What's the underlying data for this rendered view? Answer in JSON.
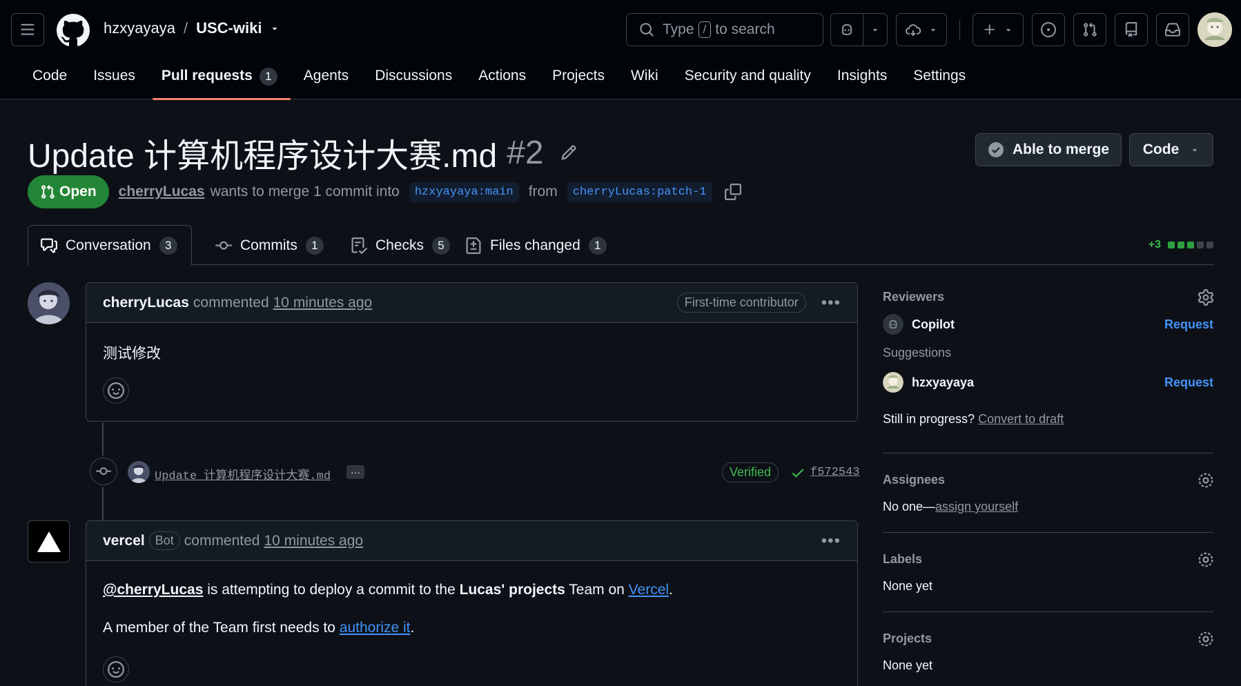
{
  "header": {
    "owner": "hzxyayaya",
    "separator": "/",
    "repo": "USC-wiki",
    "search_prefix": "Type",
    "search_key": "/",
    "search_suffix": "to search"
  },
  "nav": [
    {
      "label": "Code"
    },
    {
      "label": "Issues"
    },
    {
      "label": "Pull requests",
      "count": "1"
    },
    {
      "label": "Agents"
    },
    {
      "label": "Discussions"
    },
    {
      "label": "Actions"
    },
    {
      "label": "Projects"
    },
    {
      "label": "Wiki"
    },
    {
      "label": "Security and quality"
    },
    {
      "label": "Insights"
    },
    {
      "label": "Settings"
    }
  ],
  "pr": {
    "title": "Update 计算机程序设计大赛.md",
    "number": "#2",
    "state": "Open",
    "author": "cherryLucas",
    "merge_text": "wants to merge 1 commit into",
    "base_branch": "hzxyayaya:main",
    "from_text": "from",
    "head_branch": "cherryLucas:patch-1",
    "merge_status": "Able to merge",
    "code_button": "Code"
  },
  "tabs": [
    {
      "label": "Conversation",
      "count": "3"
    },
    {
      "label": "Commits",
      "count": "1"
    },
    {
      "label": "Checks",
      "count": "5"
    },
    {
      "label": "Files changed",
      "count": "1"
    }
  ],
  "diffstat": "+3",
  "comment1": {
    "author": "cherryLucas",
    "action": "commented",
    "time": "10 minutes ago",
    "badge": "First-time contributor",
    "body": "测试修改"
  },
  "commit": {
    "message": "Update 计算机程序设计大赛.md",
    "more": "···",
    "verified": "Verified",
    "sha": "f572543"
  },
  "comment2": {
    "author": "vercel",
    "badge": "Bot",
    "action": "commented",
    "time": "10 minutes ago",
    "mention": "@cherryLucas",
    "line1_a": "is attempting to deploy a commit to the",
    "team": "Lucas' projects",
    "line1_b": "Team on",
    "vercel_link": "Vercel",
    "period": ".",
    "line2_a": "A member of the Team first needs to",
    "authorize_link": "authorize it",
    "period2": "."
  },
  "sidebar": {
    "reviewers_label": "Reviewers",
    "reviewer_name": "Copilot",
    "request": "Request",
    "suggestions_label": "Suggestions",
    "suggested_name": "hzxyayaya",
    "draft_text": "Still in progress?",
    "draft_link": "Convert to draft",
    "assignees_label": "Assignees",
    "assignees_none": "No one—",
    "assign_link": "assign yourself",
    "labels_label": "Labels",
    "labels_value": "None yet",
    "projects_label": "Projects",
    "projects_value": "None yet"
  },
  "colors": {
    "accent_link": "#4493f8",
    "open_green": "#238636",
    "active_tab_underline": "#f78166"
  }
}
